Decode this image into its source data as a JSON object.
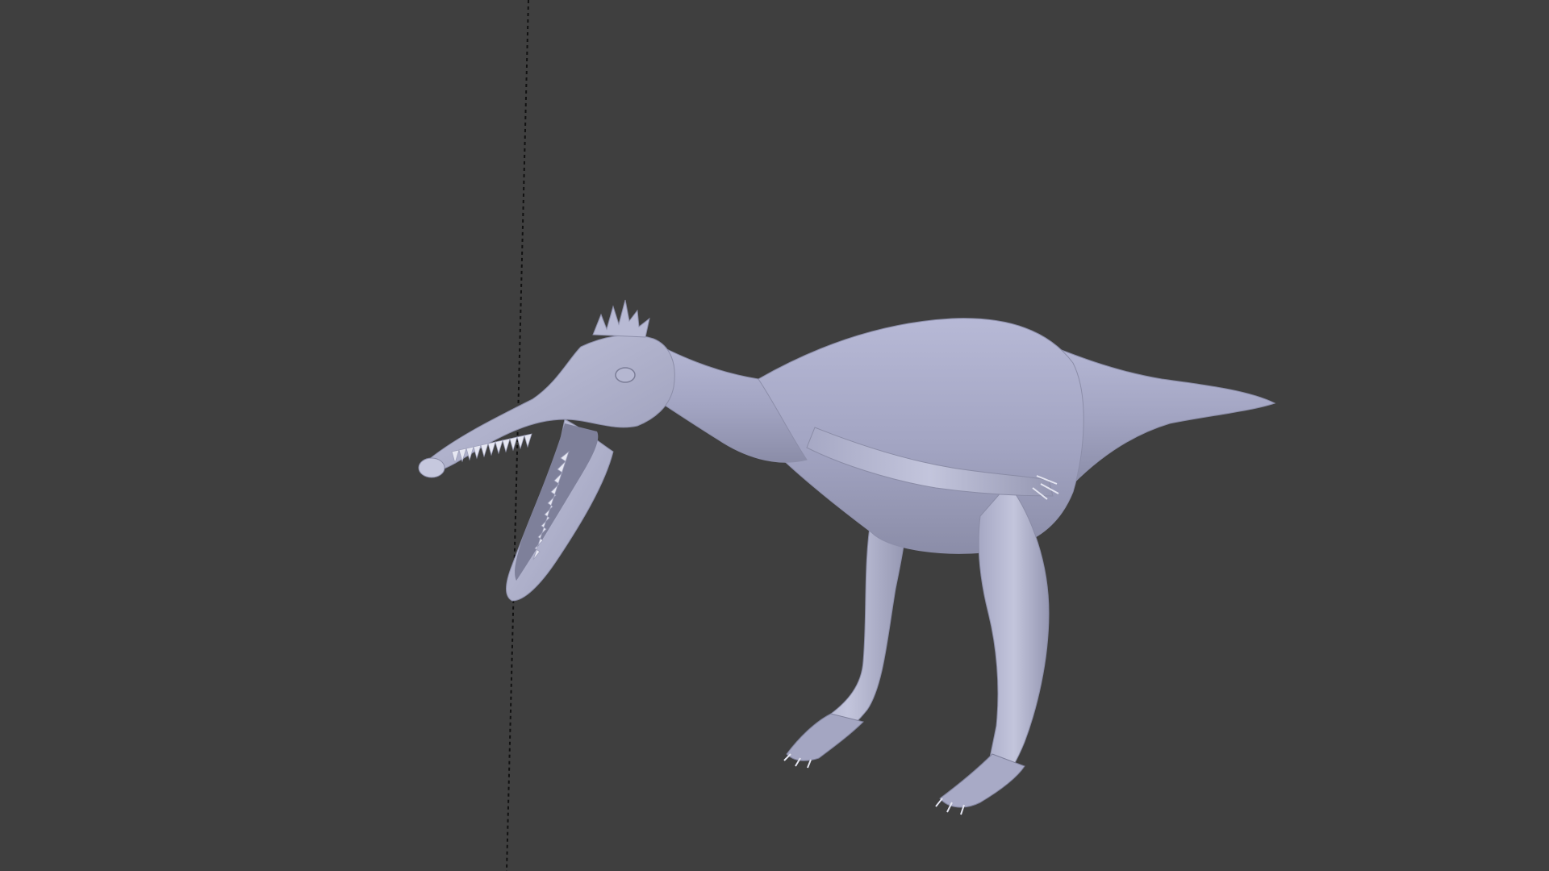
{
  "viewport": {
    "background_color": "#3f3f3f",
    "object": "dinosaur-sculpt-mesh",
    "object_color": "#a9abc9",
    "shading": "solid",
    "guide_line": "dashed-vertical"
  }
}
